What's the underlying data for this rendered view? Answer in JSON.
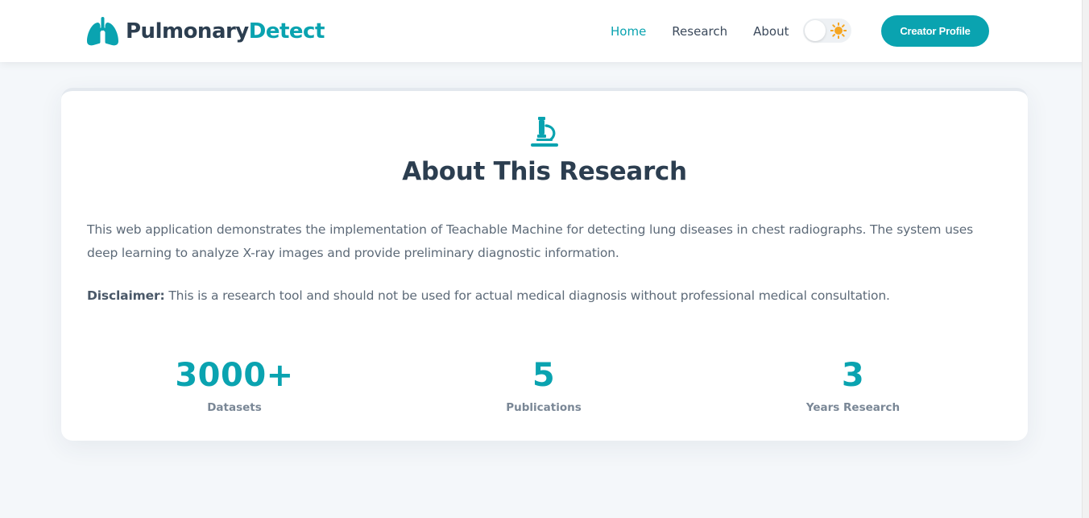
{
  "brand": {
    "name_primary": "Pulmonary",
    "name_accent": "Detect",
    "icon": "lungs-icon"
  },
  "nav": {
    "items": [
      {
        "label": "Home",
        "active": true
      },
      {
        "label": "Research",
        "active": false
      },
      {
        "label": "About",
        "active": false
      }
    ],
    "theme_toggle": {
      "icon": "sun-icon",
      "mode": "light"
    },
    "cta_label": "Creator Profile"
  },
  "about": {
    "icon": "microscope-icon",
    "title": "About This Research",
    "description": "This web application demonstrates the implementation of Teachable Machine for detecting lung diseases in chest radiographs. The system uses deep learning to analyze X-ray images and provide preliminary diagnostic information.",
    "disclaimer_label": "Disclaimer:",
    "disclaimer_text": " This is a research tool and should not be used for actual medical diagnosis without professional medical consultation.",
    "stats": [
      {
        "value": "3000+",
        "label": "Datasets"
      },
      {
        "value": "5",
        "label": "Publications"
      },
      {
        "value": "3",
        "label": "Years Research"
      }
    ]
  },
  "colors": {
    "accent": "#0aa3b0",
    "text_dark": "#2c3e50",
    "text_muted": "#5d6a78",
    "background": "#f4f7fa",
    "sun": "#f5a623"
  }
}
